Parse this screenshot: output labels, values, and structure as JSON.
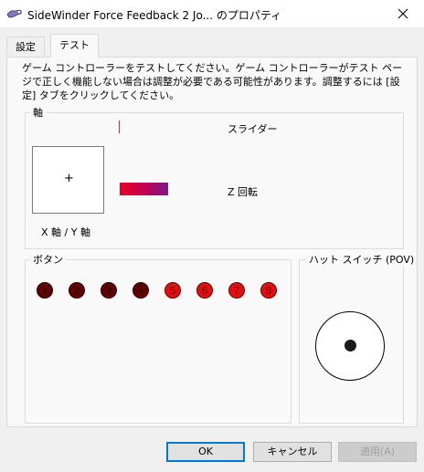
{
  "window": {
    "title": "SideWinder Force Feedback 2 Jo... のプロパティ",
    "app_icon": "joystick-icon",
    "close_icon": "close-icon"
  },
  "tabs": [
    {
      "label": "設定",
      "active": false
    },
    {
      "label": "テスト",
      "active": true
    }
  ],
  "instructions": "ゲーム コントローラーをテストしてください。ゲーム コントローラーがテスト ページで正しく機能しない場合は調整が必要である可能性があります。調整するには [設定] タブをクリックしてください。",
  "axes": {
    "group_label": "軸",
    "xy_label": "X 軸 / Y 軸",
    "crosshair": "+",
    "slider_label": "スライダー",
    "z_rotation_label": "Z 回転"
  },
  "buttons_group": {
    "label": "ボタン",
    "buttons": [
      {
        "number": "1",
        "pressed": false
      },
      {
        "number": "2",
        "pressed": false
      },
      {
        "number": "3",
        "pressed": false
      },
      {
        "number": "4",
        "pressed": false
      },
      {
        "number": "5",
        "pressed": true
      },
      {
        "number": "6",
        "pressed": true
      },
      {
        "number": "7",
        "pressed": true
      },
      {
        "number": "8",
        "pressed": true
      }
    ]
  },
  "pov": {
    "label": "ハット スイッチ (POV)"
  },
  "footer": {
    "ok": "OK",
    "cancel": "キャンセル",
    "apply": "適用(A)"
  },
  "colors": {
    "button_idle": "#5e0005",
    "button_active": "#e01010",
    "z_rotation_bar_start": "#e40025",
    "z_rotation_bar_end": "#7a1b88",
    "slider_marker": "#d82a3d",
    "focus_border": "#0078d7"
  }
}
